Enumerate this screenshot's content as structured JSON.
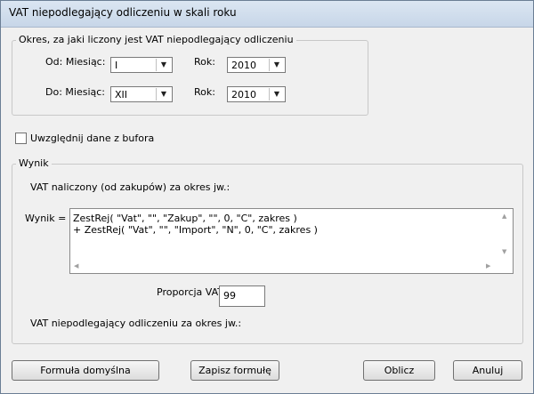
{
  "window": {
    "title": "VAT niepodlegający odliczeniu w skali roku"
  },
  "period_group": {
    "legend": "Okres, za jaki liczony jest VAT niepodlegający odliczeniu",
    "from_label": "Od: Miesiąc:",
    "from_month": "I",
    "from_year_label": "Rok:",
    "from_year": "2010",
    "to_label": "Do: Miesiąc:",
    "to_month": "XII",
    "to_year_label": "Rok:",
    "to_year": "2010"
  },
  "buffer_checkbox": {
    "label": "Uwzględnij dane z bufora",
    "checked": false
  },
  "result_group": {
    "legend": "Wynik",
    "vat_charged_label": "VAT naliczony (od zakupów) za okres jw.:",
    "result_label": "Wynik =",
    "formula_lines": [
      "ZestRej( \"Vat\", \"\", \"Zakup\", \"\", 0, \"C\", zakres )",
      "+ ZestRej( \"Vat\", \"\", \"Import\", \"N\", 0, \"C\", zakres )"
    ],
    "proportion_label": "Proporcja VAT (%)",
    "proportion_value": "99",
    "non_deductible_label": "VAT niepodlegający odliczeniu za okres jw.:"
  },
  "buttons": {
    "default_formula": "Formuła domyślna",
    "save_formula": "Zapisz formułę",
    "calculate": "Oblicz",
    "cancel": "Anuluj"
  }
}
